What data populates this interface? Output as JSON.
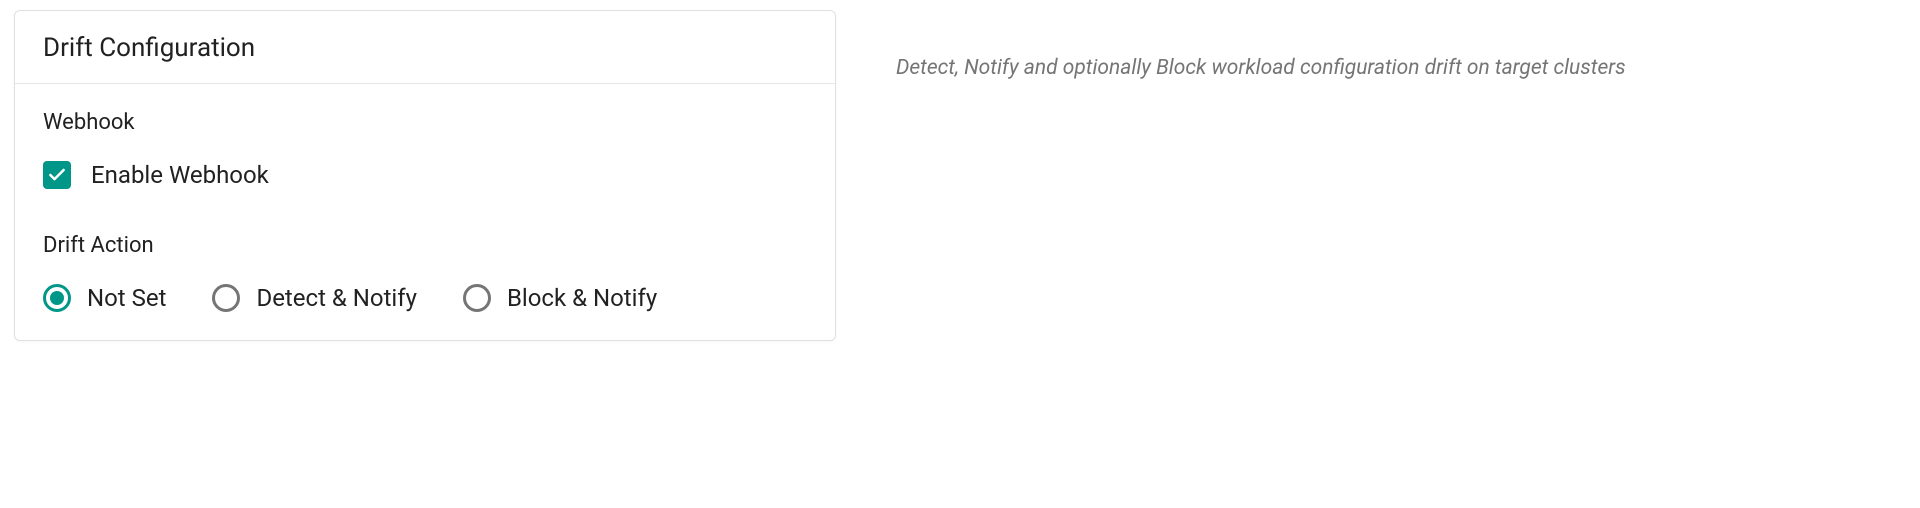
{
  "card": {
    "title": "Drift Configuration",
    "webhook": {
      "section_label": "Webhook",
      "checkbox_label": "Enable Webhook",
      "checked": true
    },
    "drift_action": {
      "section_label": "Drift Action",
      "options": [
        {
          "label": "Not Set",
          "selected": true
        },
        {
          "label": "Detect & Notify",
          "selected": false
        },
        {
          "label": "Block & Notify",
          "selected": false
        }
      ]
    }
  },
  "description": "Detect, Notify and optionally Block workload configuration drift on target clusters",
  "colors": {
    "accent": "#009688",
    "text": "#212121",
    "muted": "#757575",
    "border": "#e0e0e0"
  }
}
